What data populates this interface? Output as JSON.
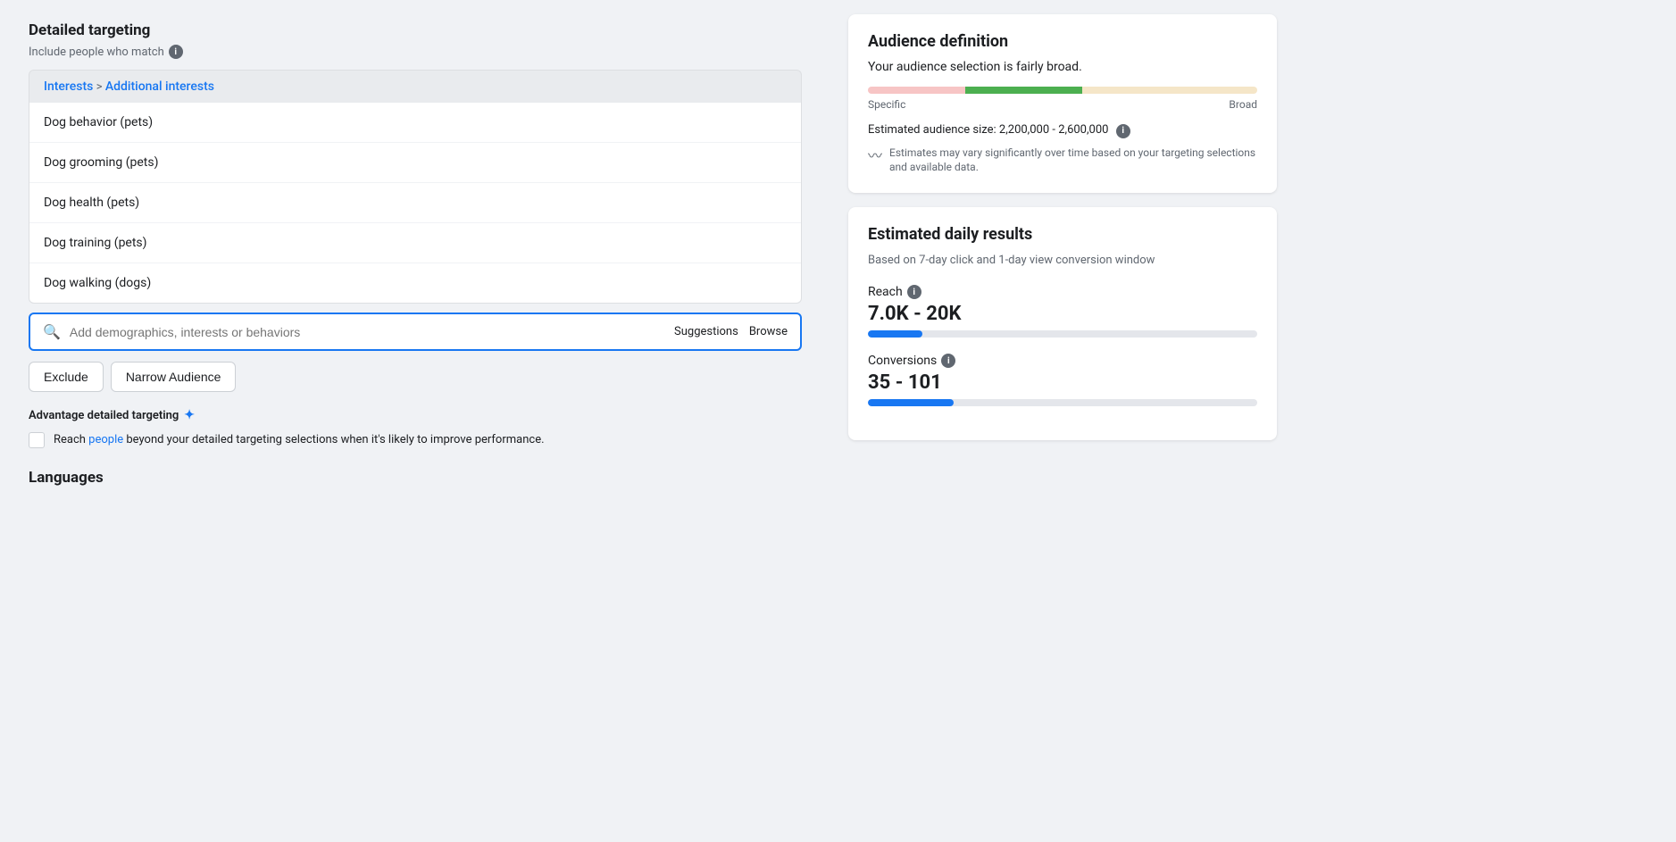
{
  "left": {
    "section_title": "Detailed targeting",
    "section_subtitle": "Include people who match",
    "breadcrumb": {
      "part1": "Interests",
      "separator": ">",
      "part2": "Additional interests"
    },
    "interest_items": [
      "Dog behavior (pets)",
      "Dog grooming (pets)",
      "Dog health (pets)",
      "Dog training (pets)",
      "Dog walking (dogs)"
    ],
    "search_placeholder": "Add demographics, interests or behaviors",
    "search_action1": "Suggestions",
    "search_action2": "Browse",
    "buttons": {
      "exclude": "Exclude",
      "narrow": "Narrow Audience"
    },
    "advantage": {
      "title": "Advantage detailed targeting",
      "text_before": "Reach ",
      "link": "people",
      "text_after": " beyond your detailed targeting selections when it's likely to improve performance."
    },
    "languages_title": "Languages"
  },
  "right": {
    "audience_card": {
      "title": "Audience definition",
      "subtitle": "Your audience selection is fairly broad.",
      "label_specific": "Specific",
      "label_broad": "Broad",
      "audience_size_label": "Estimated audience size: 2,200,000 - 2,600,000",
      "estimates_note": "Estimates may vary significantly over time based on your targeting selections and available data."
    },
    "daily_results_card": {
      "title": "Estimated daily results",
      "subtitle": "Based on 7-day click and 1-day view conversion window",
      "reach_label": "Reach",
      "reach_value": "7.0K - 20K",
      "conversions_label": "Conversions",
      "conversions_value": "35 - 101"
    }
  }
}
